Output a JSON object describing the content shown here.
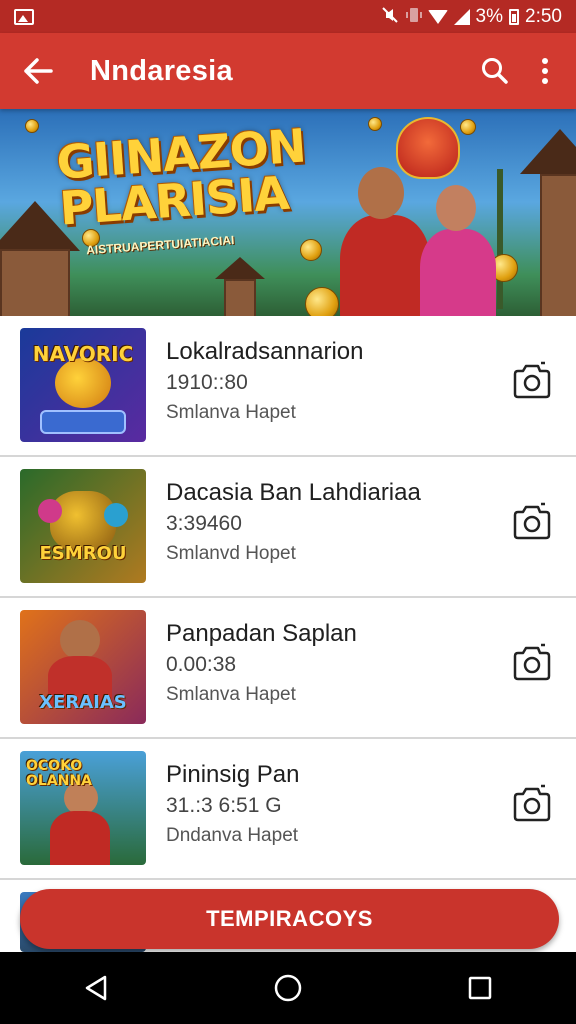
{
  "status_bar": {
    "battery_percent": "3%",
    "time": "2:50",
    "icons": [
      "image-icon",
      "mute-icon",
      "vibrate-icon",
      "wifi-icon",
      "signal-icon",
      "battery-icon"
    ]
  },
  "app_bar": {
    "title": "Nndaresia",
    "color": "#d23a30",
    "status_color": "#b42a24"
  },
  "banner": {
    "title_line1": "GIINAZON",
    "title_line2": "PLARISIA",
    "subtitle": "AISTRUAPERTUIATIACIAI"
  },
  "items": [
    {
      "title": "Lokalradsannarion",
      "time": "1910::80",
      "subtitle": "Smlanva Hapet",
      "thumb_text": "NAVORIC",
      "thumb_colors": [
        "#1a3a9a",
        "#5a2aa0"
      ]
    },
    {
      "title": "Dacasia Ban Lahdiariaa",
      "time": "3:39460",
      "subtitle": "Smlanvd Hopet",
      "thumb_text": "ESMROU",
      "thumb_colors": [
        "#2a6a2a",
        "#b07a20"
      ]
    },
    {
      "title": "Panpadan Saplan",
      "time": "0.00:38",
      "subtitle": "Smlanva Hapet",
      "thumb_text": "XERAIAS",
      "thumb_colors": [
        "#e0721a",
        "#8a2a5a"
      ]
    },
    {
      "title": "Pininsig Pan",
      "time": "31.:3 6:51 G",
      "subtitle": "Dndanva Hapet",
      "thumb_text": "OCOKO OLANNA",
      "thumb_colors": [
        "#4aa0d8",
        "#2a6a3a"
      ]
    }
  ],
  "bottom_button": {
    "label": "TEMPIRACOYS"
  }
}
